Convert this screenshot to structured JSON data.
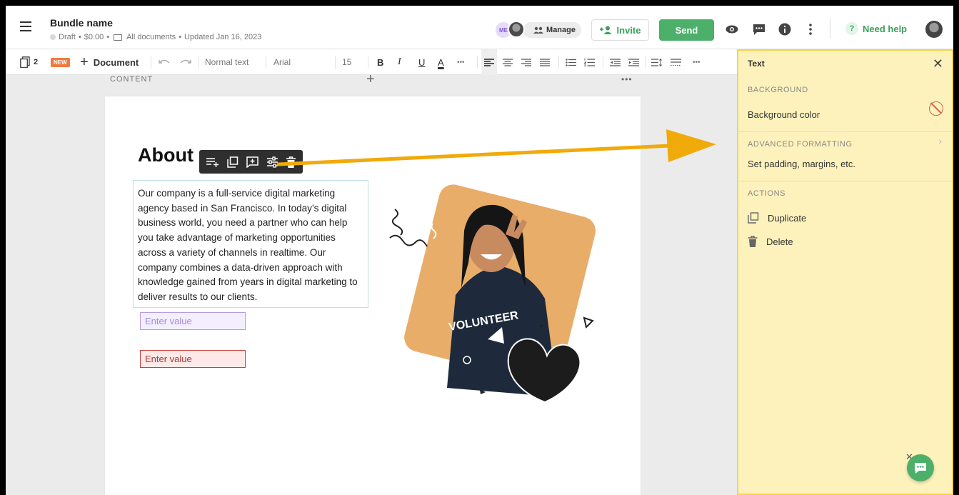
{
  "header": {
    "title": "Bundle name",
    "status": "Draft",
    "price": "$0.00",
    "folder": "All documents",
    "updated": "Updated Jan 16, 2023",
    "me_badge": "ME",
    "manage_label": "Manage",
    "invite_label": "Invite",
    "send_label": "Send",
    "help_label": "Need help",
    "icons": [
      "menu-icon",
      "eye-icon",
      "comment-icon",
      "info-icon",
      "more-vertical-icon",
      "help-icon",
      "user-avatar"
    ]
  },
  "toolbar": {
    "doc_count": "2",
    "new_badge": "NEW",
    "document_label": "Document",
    "style": "Normal text",
    "font": "Arial",
    "size": "15",
    "bold": "B",
    "italic": "I",
    "underline": "U",
    "text_color": "A",
    "more": "•••"
  },
  "canvas": {
    "section_label": "CONTENT",
    "heading": "About",
    "body": "Our company is a full-service digital marketing agency based in San Francisco. In today’s digital business world, you need a partner who can help you take advantage of marketing opportunities across a variety of channels in realtime. Our company combines a data-driven approach with knowledge gained from years in digital marketing to deliver results to our clients.",
    "field1_placeholder": "Enter value",
    "field2_placeholder": "Enter value",
    "image_shirt_text": "VOLUNTEER"
  },
  "panel": {
    "title": "Text",
    "background_section": "BACKGROUND",
    "background_color": "Background color",
    "advanced_section": "ADVANCED FORMATTING",
    "advanced_desc": "Set padding, margins, etc.",
    "actions_section": "ACTIONS",
    "duplicate": "Duplicate",
    "delete": "Delete"
  },
  "colors": {
    "accent_green": "#4caf6a",
    "panel_bg": "#fdf2bc",
    "panel_border": "#f4d548",
    "arrow": "#f0aa0a",
    "new_badge": "#f07a3b"
  }
}
